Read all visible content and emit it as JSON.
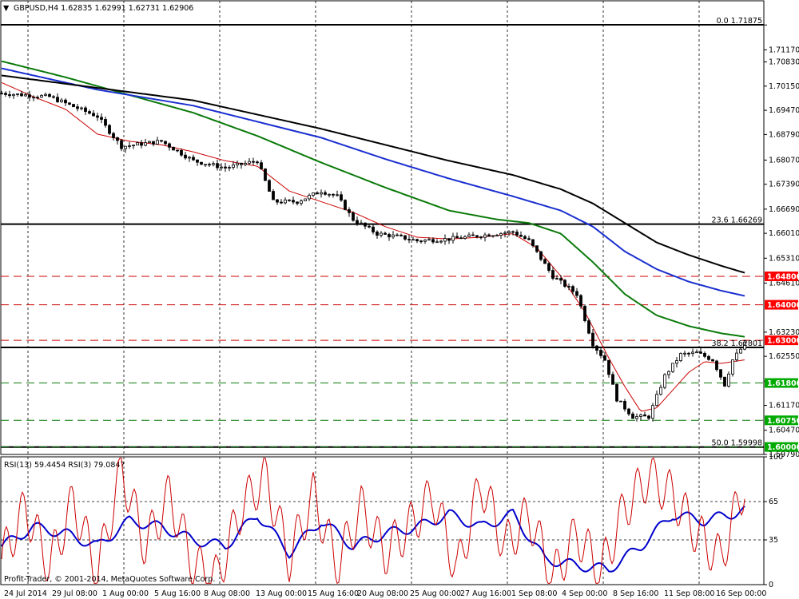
{
  "chart_data": [
    {
      "type": "line",
      "panel": "price",
      "header": "GBPUSD,H4  1.62835 1.62991 1.62731 1.62906",
      "ylim": [
        1.5979,
        1.7255
      ],
      "y_ticks": [
        1.7187,
        1.7117,
        1.7083,
        1.7015,
        1.6947,
        1.6879,
        1.6807,
        1.6739,
        1.6669,
        1.6601,
        1.6531,
        1.6461,
        1.6323,
        1.6255,
        1.6185,
        1.6117,
        1.6047,
        1.5979
      ],
      "y_tick_labels": [
        "",
        "1.71170",
        "1.70830",
        "1.70150",
        "1.69470",
        "1.68790",
        "1.68070",
        "1.67390",
        "1.66690",
        "1.66010",
        "1.65310",
        "1.64610",
        "1.63230",
        "1.62550",
        "",
        "1.61170",
        "1.60470",
        "1.59790"
      ],
      "x_ticks": [
        "24 Jul 2014",
        "29 Jul 08:00",
        "1 Aug 00:00",
        "5 Aug 16:00",
        "8 Aug 08:00",
        "13 Aug 00:00",
        "15 Aug 16:00",
        "20 Aug 08:00",
        "25 Aug 00:00",
        "27 Aug 16:00",
        "1 Sep 08:00",
        "4 Sep 00:00",
        "8 Sep 16:00",
        "11 Sep 08:00",
        "16 Sep 00:00"
      ],
      "fib_levels": [
        {
          "label": "0.0 1.71875",
          "value": 1.71875
        },
        {
          "label": "23.6 1.66269",
          "value": 1.66269
        },
        {
          "label": "38.2 1.62801",
          "value": 1.62801
        },
        {
          "label": "50.0 1.59998",
          "value": 1.59998
        }
      ],
      "resistance_levels": [
        {
          "label": "1.64800",
          "value": 1.648
        },
        {
          "label": "1.64000",
          "value": 1.64
        },
        {
          "label": "1.63000",
          "value": 1.63
        }
      ],
      "support_levels": [
        {
          "label": "1.61800",
          "value": 1.618
        },
        {
          "label": "1.60750",
          "value": 1.6075
        },
        {
          "label": "1.60000",
          "value": 1.6
        }
      ],
      "colors": {
        "candles": "#000000",
        "ma_fast": "#cc0000",
        "ma_mid": "#0a7a0a",
        "ma_slow": "#1a2fd0",
        "ma_long": "#000000",
        "resistance": "#cc0000",
        "support": "#0a7a0a",
        "label_red_bg": "#ff0000",
        "label_green_bg": "#00aa00"
      },
      "series": [
        {
          "key": "price",
          "x": [
            0,
            60,
            120,
            150,
            200,
            240,
            280,
            320,
            340,
            370,
            400,
            420,
            440,
            470,
            500,
            520,
            560,
            600,
            640,
            660,
            690,
            720,
            740,
            755,
            770,
            790,
            810,
            830,
            850,
            870,
            890,
            905,
            915,
            930
          ],
          "y": [
            1.6995,
            1.6985,
            1.693,
            1.6845,
            1.686,
            1.6805,
            1.6785,
            1.6805,
            1.669,
            1.669,
            1.672,
            1.6705,
            1.664,
            1.66,
            1.659,
            1.658,
            1.6585,
            1.6595,
            1.6605,
            1.658,
            1.648,
            1.643,
            1.629,
            1.6245,
            1.6135,
            1.6085,
            1.6085,
            1.62,
            1.626,
            1.6265,
            1.6245,
            1.6175,
            1.6245,
            1.629
          ]
        },
        {
          "key": "ma_fast",
          "x": [
            0,
            40,
            80,
            120,
            160,
            200,
            240,
            280,
            320,
            360,
            400,
            440,
            480,
            520,
            560,
            600,
            640,
            670,
            700,
            730,
            760,
            780,
            800,
            820,
            840,
            860,
            880,
            900,
            930
          ],
          "y": [
            1.7025,
            1.6985,
            1.695,
            1.688,
            1.686,
            1.685,
            1.683,
            1.6805,
            1.679,
            1.672,
            1.669,
            1.666,
            1.662,
            1.659,
            1.6585,
            1.659,
            1.66,
            1.656,
            1.648,
            1.638,
            1.625,
            1.617,
            1.61,
            1.611,
            1.616,
            1.621,
            1.624,
            1.6235,
            1.6245
          ]
        },
        {
          "key": "ma_mid",
          "x": [
            0,
            80,
            160,
            240,
            320,
            400,
            480,
            560,
            620,
            660,
            700,
            740,
            780,
            820,
            860,
            900,
            930
          ],
          "y": [
            1.7085,
            1.704,
            1.699,
            1.694,
            1.6875,
            1.68,
            1.673,
            1.6665,
            1.664,
            1.663,
            1.66,
            1.652,
            1.643,
            1.637,
            1.634,
            1.632,
            1.631
          ]
        },
        {
          "key": "ma_slow",
          "x": [
            0,
            120,
            240,
            320,
            400,
            480,
            560,
            640,
            700,
            740,
            780,
            820,
            860,
            900,
            930
          ],
          "y": [
            1.7065,
            1.7005,
            1.696,
            1.6915,
            1.687,
            1.681,
            1.6755,
            1.6705,
            1.6665,
            1.662,
            1.655,
            1.65,
            1.6465,
            1.644,
            1.6425
          ]
        },
        {
          "key": "ma_long",
          "x": [
            0,
            120,
            240,
            320,
            400,
            480,
            560,
            640,
            700,
            740,
            780,
            820,
            860,
            900,
            930
          ],
          "y": [
            1.7045,
            1.701,
            1.6975,
            1.6935,
            1.6895,
            1.685,
            1.6805,
            1.6765,
            1.6725,
            1.6685,
            1.663,
            1.6575,
            1.654,
            1.651,
            1.649
          ]
        }
      ]
    },
    {
      "type": "line",
      "panel": "oscillator",
      "header": "RSI(13) 59.4454  RSI(3) 79.0847",
      "ylim": [
        0,
        100
      ],
      "y_ticks": [
        0,
        35,
        65,
        100
      ],
      "y_tick_labels": [
        "0",
        "35",
        "65",
        "100"
      ],
      "levels": [
        35,
        65
      ],
      "series": [
        {
          "key": "rsi13",
          "color": "#0000cc",
          "x": [
            0,
            40,
            80,
            120,
            160,
            200,
            240,
            280,
            320,
            360,
            400,
            440,
            480,
            520,
            560,
            600,
            640,
            680,
            720,
            760,
            800,
            840,
            880,
            930
          ],
          "y": [
            30,
            45,
            40,
            30,
            50,
            45,
            35,
            30,
            55,
            25,
            50,
            30,
            40,
            45,
            55,
            45,
            55,
            20,
            15,
            12,
            30,
            55,
            50,
            58
          ]
        },
        {
          "key": "rsi3",
          "color": "#cc0000",
          "x": [
            0,
            30,
            60,
            90,
            120,
            150,
            180,
            210,
            240,
            270,
            300,
            330,
            360,
            390,
            420,
            450,
            480,
            510,
            540,
            570,
            600,
            630,
            660,
            690,
            720,
            750,
            780,
            810,
            840,
            870,
            900,
            930
          ],
          "y": [
            20,
            60,
            15,
            65,
            10,
            90,
            30,
            70,
            15,
            5,
            60,
            85,
            20,
            70,
            15,
            60,
            25,
            45,
            70,
            10,
            80,
            30,
            55,
            5,
            40,
            10,
            60,
            85,
            70,
            40,
            20,
            79
          ]
        }
      ]
    }
  ],
  "footer": {
    "copyright": "Profit-Trader, © 2001-2014, MetaQuotes Software Corp."
  }
}
